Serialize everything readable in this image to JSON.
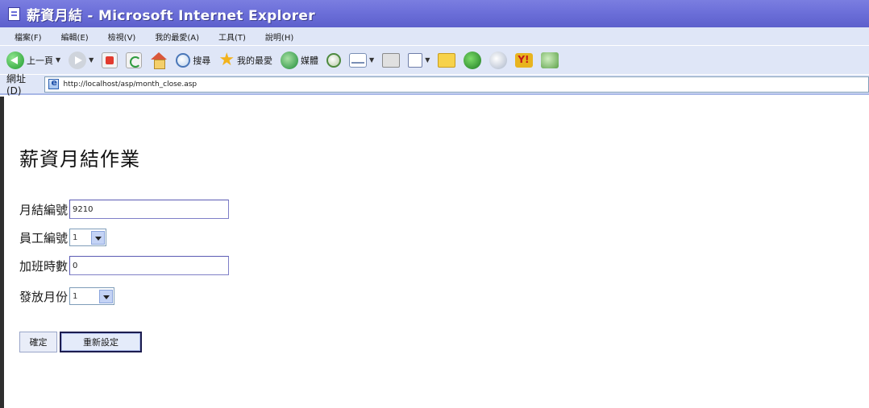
{
  "window": {
    "title": "薪資月結 - Microsoft Internet Explorer"
  },
  "menu": {
    "items": [
      "檔案(F)",
      "編輯(E)",
      "檢視(V)",
      "我的最愛(A)",
      "工具(T)",
      "說明(H)"
    ]
  },
  "toolbar": {
    "back_label": "上一頁",
    "search_label": "搜尋",
    "favorites_label": "我的最愛",
    "media_label": "媒體"
  },
  "address": {
    "label": "網址(D)",
    "url": "http://localhost/asp/month_close.asp"
  },
  "page": {
    "title": "薪資月結作業"
  },
  "form": {
    "month_close_no_label": "月結編號",
    "month_close_no_value": "9210",
    "employee_no_label": "員工編號",
    "employee_no_value": "1",
    "overtime_hours_label": "加班時數",
    "overtime_hours_value": "0",
    "pay_month_label": "發放月份",
    "pay_month_value": "1"
  },
  "buttons": {
    "submit_label": "確定",
    "reset_label": "重新設定"
  }
}
